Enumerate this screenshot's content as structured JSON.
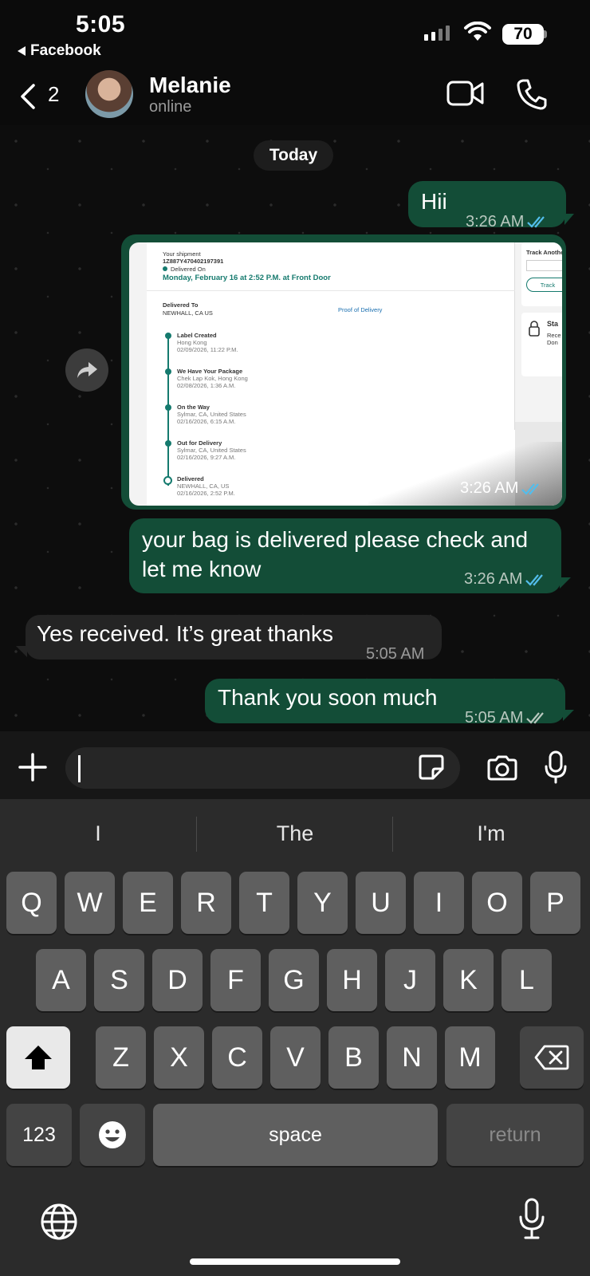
{
  "status_bar": {
    "time": "5:05",
    "back_app": "Facebook",
    "battery": "70"
  },
  "header": {
    "unread_count": "2",
    "contact_name": "Melanie",
    "presence": "online"
  },
  "chat": {
    "day_label": "Today",
    "messages": [
      {
        "dir": "out",
        "text": "Hii",
        "time": "3:26 AM",
        "status": "read"
      },
      {
        "dir": "out",
        "type": "image",
        "time": "3:26 AM",
        "status": "read"
      },
      {
        "dir": "out",
        "text_line1": "your bag is delivered please check and",
        "text_line2": "let me know",
        "time": "3:26 AM",
        "status": "read"
      },
      {
        "dir": "in",
        "text": "Yes received. It’s great thanks",
        "time": "5:05 AM"
      },
      {
        "dir": "out",
        "text": "Thank you soon much",
        "time": "5:05 AM",
        "status": "delivered"
      }
    ],
    "shipment_screenshot": {
      "label": "Your shipment",
      "tracking": "1Z887Y470402197391",
      "status": "Delivered On",
      "headline": "Monday, February 16 at 2:52 P.M. at Front Door",
      "delivered_to_label": "Delivered To",
      "delivered_to": "NEWHALL, CA US",
      "proof_link": "Proof of Delivery",
      "side_title": "Track Anothe",
      "side_button": "Track",
      "side2_title": "Sta",
      "side2_l1": "Rece",
      "side2_l2": "Don",
      "events": [
        {
          "title": "Label Created",
          "place": "Hong Kong",
          "date": "02/09/2026, 11:22 P.M."
        },
        {
          "title": "We Have Your Package",
          "place": "Chek Lap Kok, Hong Kong",
          "date": "02/08/2026, 1:36 A.M."
        },
        {
          "title": "On the Way",
          "place": "Sylmar, CA, United States",
          "date": "02/16/2026, 6:15 A.M."
        },
        {
          "title": "Out for Delivery",
          "place": "Sylmar, CA, United States",
          "date": "02/16/2026, 9:27 A.M."
        },
        {
          "title": "Delivered",
          "place": "NEWHALL, CA, US",
          "date": "02/16/2026, 2:52 P.M."
        }
      ]
    }
  },
  "composer": {
    "placeholder": ""
  },
  "keyboard": {
    "suggestions": [
      "I",
      "The",
      "I'm"
    ],
    "row1": [
      "Q",
      "W",
      "E",
      "R",
      "T",
      "Y",
      "U",
      "I",
      "O",
      "P"
    ],
    "row2": [
      "A",
      "S",
      "D",
      "F",
      "G",
      "H",
      "J",
      "K",
      "L"
    ],
    "row3": [
      "Z",
      "X",
      "C",
      "V",
      "B",
      "N",
      "M"
    ],
    "numbers_key": "123",
    "space_key": "space",
    "return_key": "return"
  },
  "colors": {
    "bubble_out": "#134d37",
    "bubble_in": "#242424",
    "read_tick": "#53bdeb",
    "accent": "#157a6e"
  }
}
